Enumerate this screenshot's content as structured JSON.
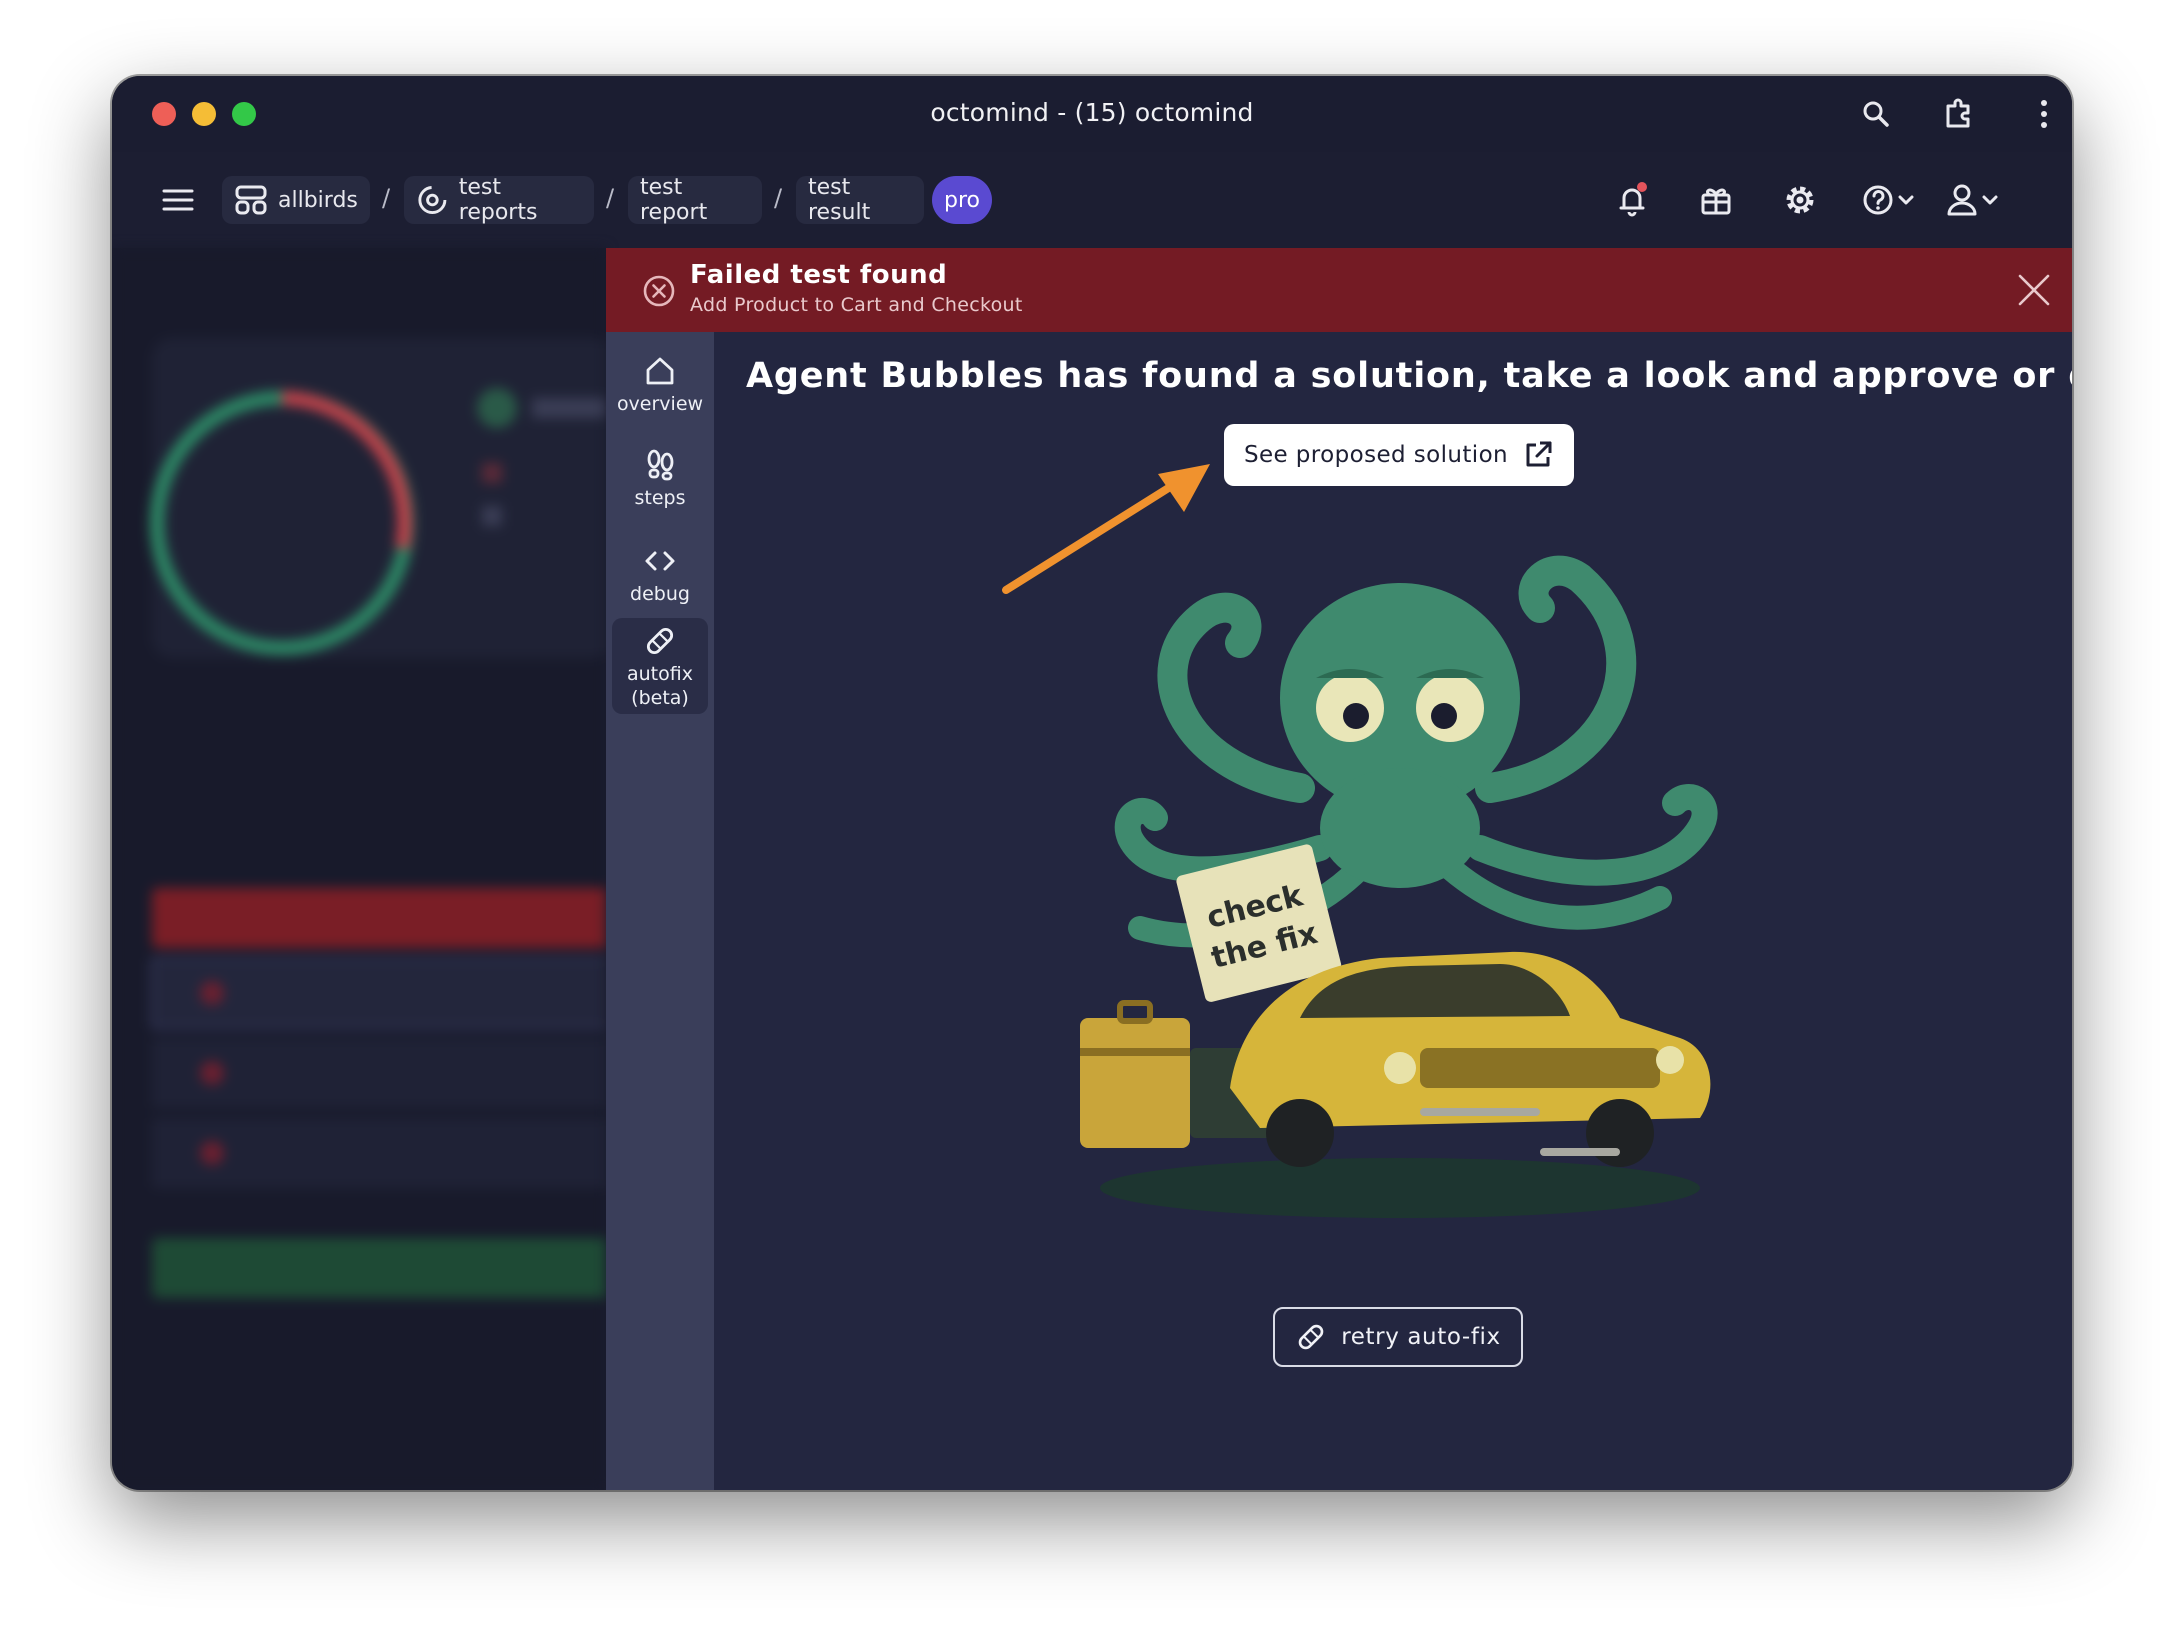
{
  "window": {
    "title": "octomind - (15) octomind"
  },
  "breadcrumb": {
    "project": "allbirds",
    "test_reports": "test reports",
    "test_report": "test report",
    "test_result": "test result",
    "separator": "/",
    "plan_badge": "pro"
  },
  "banner": {
    "title": "Failed test found",
    "subtitle": "Add Product to Cart and Checkout"
  },
  "rail": {
    "items": [
      {
        "label": "overview",
        "icon": "home-icon"
      },
      {
        "label": "steps",
        "icon": "footsteps-icon"
      },
      {
        "label": "debug",
        "icon": "code-icon"
      },
      {
        "label_line1": "autofix",
        "label_line2": "(beta)",
        "icon": "bandage-icon",
        "active": true
      }
    ]
  },
  "main": {
    "headline": "Agent Bubbles has found a solution, take a look and approve or deny it",
    "primary_button": "See proposed solution",
    "secondary_button": "retry auto-fix",
    "illustration_sign_line1": "check",
    "illustration_sign_line2": "the fix"
  },
  "colors": {
    "banner": "#741b24",
    "rail": "#3a3e5a",
    "panel": "#232640",
    "accent_arrow": "#f0922e",
    "pro_badge": "#5a4ad1",
    "octopus": "#3f8a6e",
    "car": "#d6b53a"
  }
}
